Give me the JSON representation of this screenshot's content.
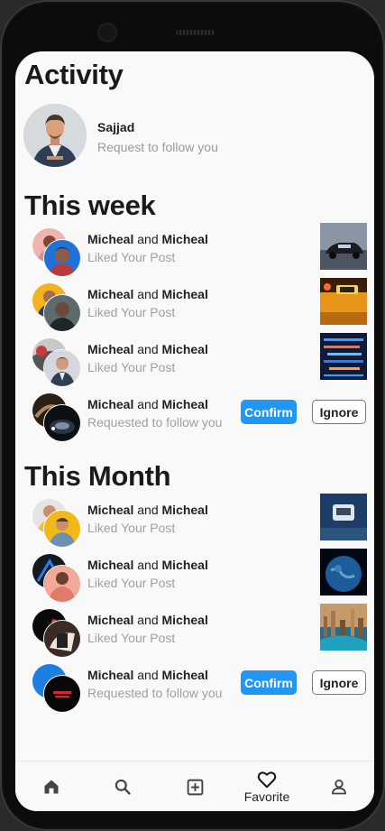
{
  "title": "Activity",
  "request": {
    "name": "Sajjad",
    "subtitle": "Request to follow you"
  },
  "sections": [
    {
      "heading": "This week"
    },
    {
      "heading": "This Month"
    }
  ],
  "week": [
    {
      "name1": "Micheal",
      "joiner": "and",
      "name2": "Micheal",
      "action": "Liked Your Post"
    },
    {
      "name1": "Micheal",
      "joiner": "and",
      "name2": "Micheal",
      "action": "Liked Your Post"
    },
    {
      "name1": "Micheal",
      "joiner": "and",
      "name2": "Micheal",
      "action": "Liked Your Post"
    },
    {
      "name1": "Micheal",
      "joiner": "and",
      "name2": "Micheal",
      "action": "Requested to follow you",
      "confirm": "Confirm",
      "ignore": "Ignore"
    }
  ],
  "month": [
    {
      "name1": "Micheal",
      "joiner": "and",
      "name2": "Micheal",
      "action": "Liked Your Post"
    },
    {
      "name1": "Micheal",
      "joiner": "and",
      "name2": "Micheal",
      "action": "Liked Your Post"
    },
    {
      "name1": "Micheal",
      "joiner": "and",
      "name2": "Micheal",
      "action": "Liked Your Post"
    },
    {
      "name1": "Micheal",
      "joiner": "and",
      "name2": "Micheal",
      "action": "Requested to follow you",
      "confirm": "Confirm",
      "ignore": "Ignore"
    }
  ],
  "nav": {
    "items": [
      {
        "icon": "home-icon"
      },
      {
        "icon": "search-icon"
      },
      {
        "icon": "add-post-icon"
      },
      {
        "icon": "heart-icon",
        "label": "Favorite",
        "active": true
      },
      {
        "icon": "profile-icon"
      }
    ]
  },
  "colors": {
    "accent": "#2196f3",
    "background": "#f9f9f9",
    "muted_text": "#a0a0a0"
  }
}
